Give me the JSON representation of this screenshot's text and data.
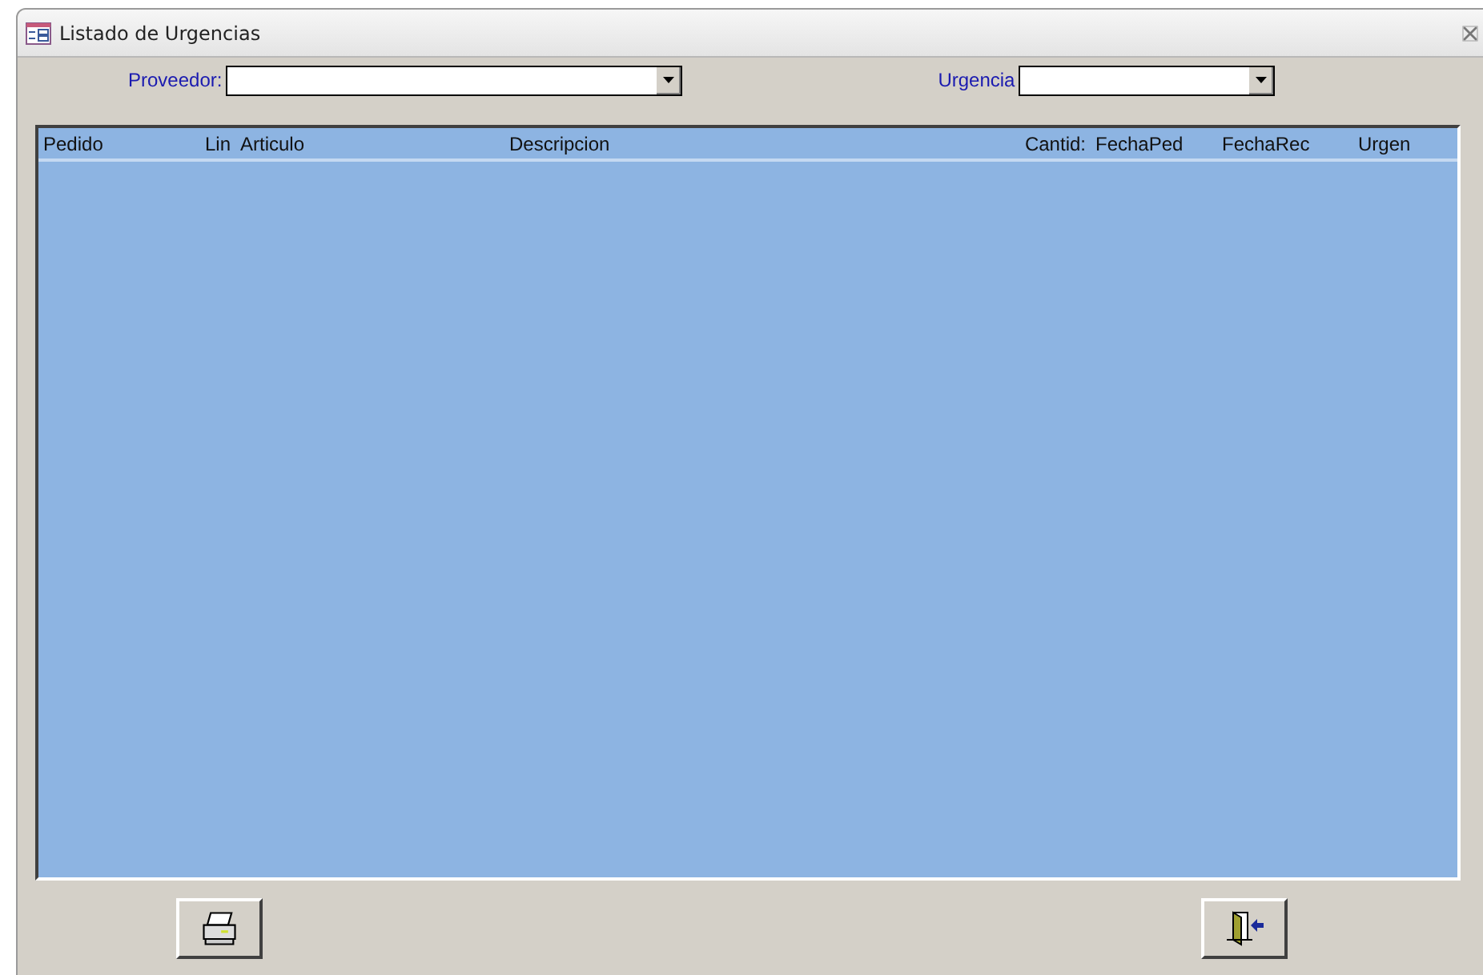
{
  "window": {
    "title": "Listado de Urgencias"
  },
  "filters": [
    {
      "label": "Proveedor:"
    },
    {
      "label": "Urgencia"
    }
  ],
  "table": {
    "columns": [
      "Pedido",
      "Lin",
      "Articulo",
      "Descripcion",
      "Cantid:",
      "FechaPed",
      "FechaRec",
      "Urgen"
    ]
  },
  "buttons": [
    {
      "kind": "print"
    },
    {
      "kind": "exit"
    }
  ]
}
